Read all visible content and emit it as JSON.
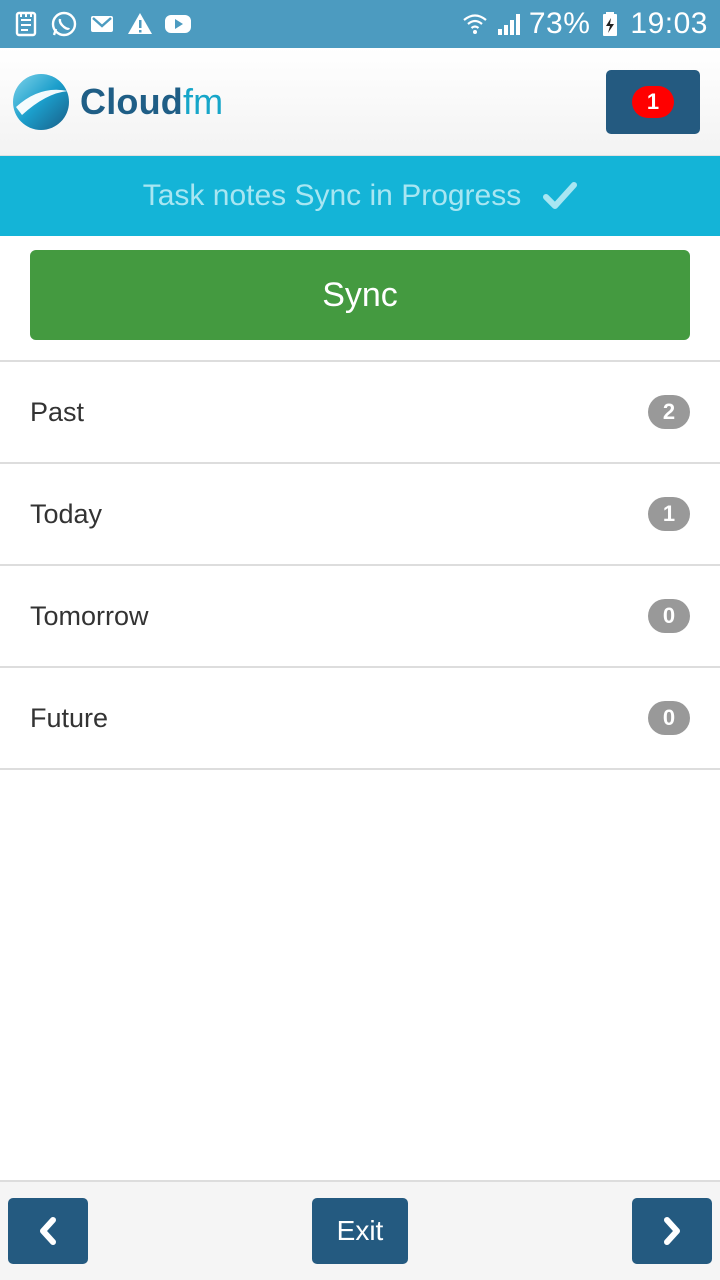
{
  "status_bar": {
    "left_icons": [
      "notes-icon",
      "whatsapp-icon",
      "gmail-icon",
      "warning-icon",
      "youtube-icon"
    ],
    "right_icons": [
      "wifi-icon",
      "signal-icon",
      "battery-charging-icon"
    ],
    "battery": "73%",
    "time": "19:03"
  },
  "header": {
    "logo_word_main": "Cloud",
    "logo_word_accent": "fm",
    "notification_count": "1"
  },
  "banner": {
    "text": "Task notes Sync in Progress",
    "icon": "check-icon"
  },
  "sync_button": {
    "label": "Sync"
  },
  "task_list": [
    {
      "label": "Past",
      "count": "2"
    },
    {
      "label": "Today",
      "count": "1"
    },
    {
      "label": "Tomorrow",
      "count": "0"
    },
    {
      "label": "Future",
      "count": "0"
    }
  ],
  "footer": {
    "prev_icon": "chevron-left-icon",
    "exit_label": "Exit",
    "next_icon": "chevron-right-icon"
  },
  "colors": {
    "status_bar": "#4c9bc0",
    "banner": "#14b4d7",
    "sync_button": "#449a40",
    "nav_button": "#245a80",
    "notification_badge": "#ff0000",
    "count_badge": "#999999"
  }
}
